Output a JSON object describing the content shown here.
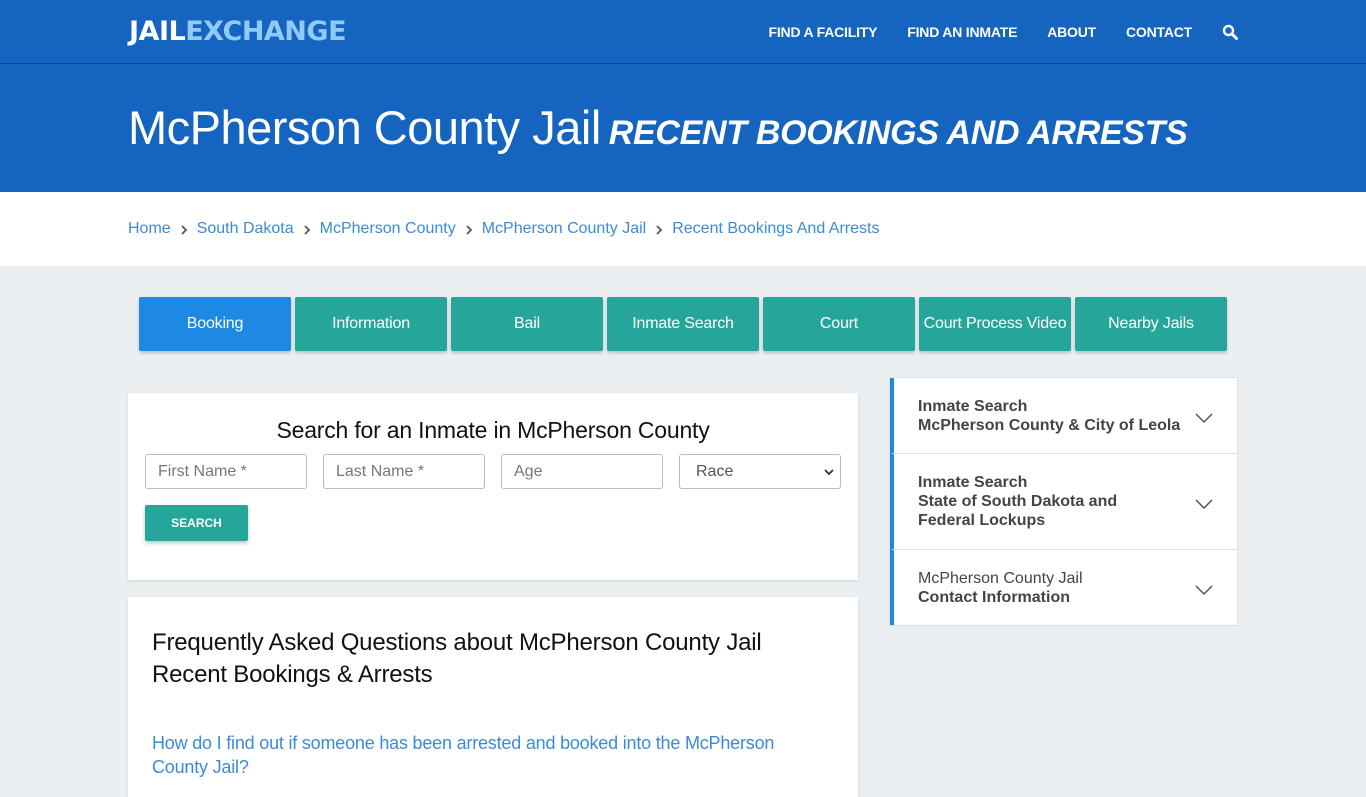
{
  "brand": {
    "part1": "JAIL",
    "part2": "EXCHANGE"
  },
  "nav": {
    "items": [
      "FIND A FACILITY",
      "FIND AN INMATE",
      "ABOUT",
      "CONTACT"
    ],
    "search_icon": "search-icon"
  },
  "hero": {
    "title": "McPherson County Jail",
    "subtitle": "RECENT BOOKINGS AND ARRESTS"
  },
  "breadcrumb": [
    "Home",
    "South Dakota",
    "McPherson County",
    "McPherson County Jail",
    "Recent Bookings And Arrests"
  ],
  "tabs": [
    {
      "label": "Booking",
      "active": true
    },
    {
      "label": "Information",
      "active": false
    },
    {
      "label": "Bail",
      "active": false
    },
    {
      "label": "Inmate Search",
      "active": false
    },
    {
      "label": "Court",
      "active": false
    },
    {
      "label": "Court Process Video",
      "active": false
    },
    {
      "label": "Nearby Jails",
      "active": false
    }
  ],
  "search": {
    "title": "Search for an Inmate in McPherson County",
    "first_name_placeholder": "First Name *",
    "last_name_placeholder": "Last Name *",
    "age_placeholder": "Age",
    "race_selected": "Race",
    "button": "SEARCH"
  },
  "faq": {
    "title_line1": "Frequently Asked Questions about McPherson County Jail",
    "title_line2": "Recent Bookings & Arrests",
    "question1": "How do I find out if someone has been arrested and booked into the McPherson County Jail?"
  },
  "sidebar": [
    {
      "line1": "Inmate Search",
      "line2": "McPherson County & City of Leola"
    },
    {
      "line1": "Inmate Search",
      "line2": "State of South Dakota and Federal Lockups"
    },
    {
      "line1": "McPherson County Jail",
      "line2": "Contact Information"
    }
  ],
  "colors": {
    "primary_blue": "#1565c0",
    "tab_teal": "#26a69a",
    "tab_active": "#1e88e5",
    "link": "#3a8bd8"
  }
}
